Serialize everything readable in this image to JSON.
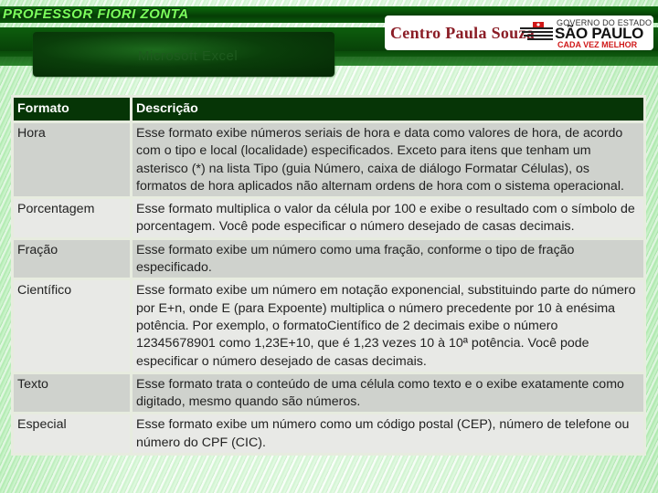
{
  "header": {
    "brand": "PROFESSOR FIORI ZONTA",
    "slide_title": "Microsoft Excel",
    "logo_left": "Centro Paula Souza",
    "logo_right": {
      "line1": "GOVERNO DO ESTADO",
      "line2": "SÃO PAULO",
      "line3": "CADA VEZ MELHOR"
    }
  },
  "colors": {
    "header_row": "#063506",
    "row_dark": "#cfd2cd",
    "row_light": "#e8e9e6",
    "brand_text": "#7bff5c",
    "logo_red": "#d01818",
    "cps_red": "#8b1d26"
  },
  "table": {
    "columns": [
      "Formato",
      "Descrição"
    ],
    "rows": [
      {
        "formato": "Hora",
        "descricao": "Esse formato exibe números seriais de hora e data como valores de hora, de acordo com o tipo e local (localidade) especificados. Exceto para itens que tenham um asterisco (*) na lista Tipo (guia Número, caixa de diálogo Formatar Células), os formatos de hora aplicados não alternam ordens de hora com o sistema operacional."
      },
      {
        "formato": "Porcentagem",
        "descricao": "Esse formato multiplica o valor da célula por 100 e exibe o resultado com o símbolo de porcentagem. Você pode especificar o número desejado de casas decimais."
      },
      {
        "formato": "Fração",
        "descricao": "Esse formato exibe um número como uma fração, conforme o tipo de fração especificado."
      },
      {
        "formato": "Científico",
        "descricao": "Esse formato exibe um número em notação exponencial, substituindo parte do número por E+n, onde E (para Expoente) multiplica o número precedente por 10 à enésima potência. Por exemplo, o formatoCientífico de 2 decimais exibe o número 12345678901 como 1,23E+10, que é 1,23 vezes 10 à 10ª potência. Você pode especificar o número desejado de casas decimais."
      },
      {
        "formato": "Texto",
        "descricao": "Esse formato trata o conteúdo de uma célula como texto e o exibe exatamente como digitado, mesmo quando são números."
      },
      {
        "formato": "Especial",
        "descricao": "Esse formato exibe um número como um código postal (CEP), número de telefone ou número do CPF (CIC)."
      }
    ]
  }
}
